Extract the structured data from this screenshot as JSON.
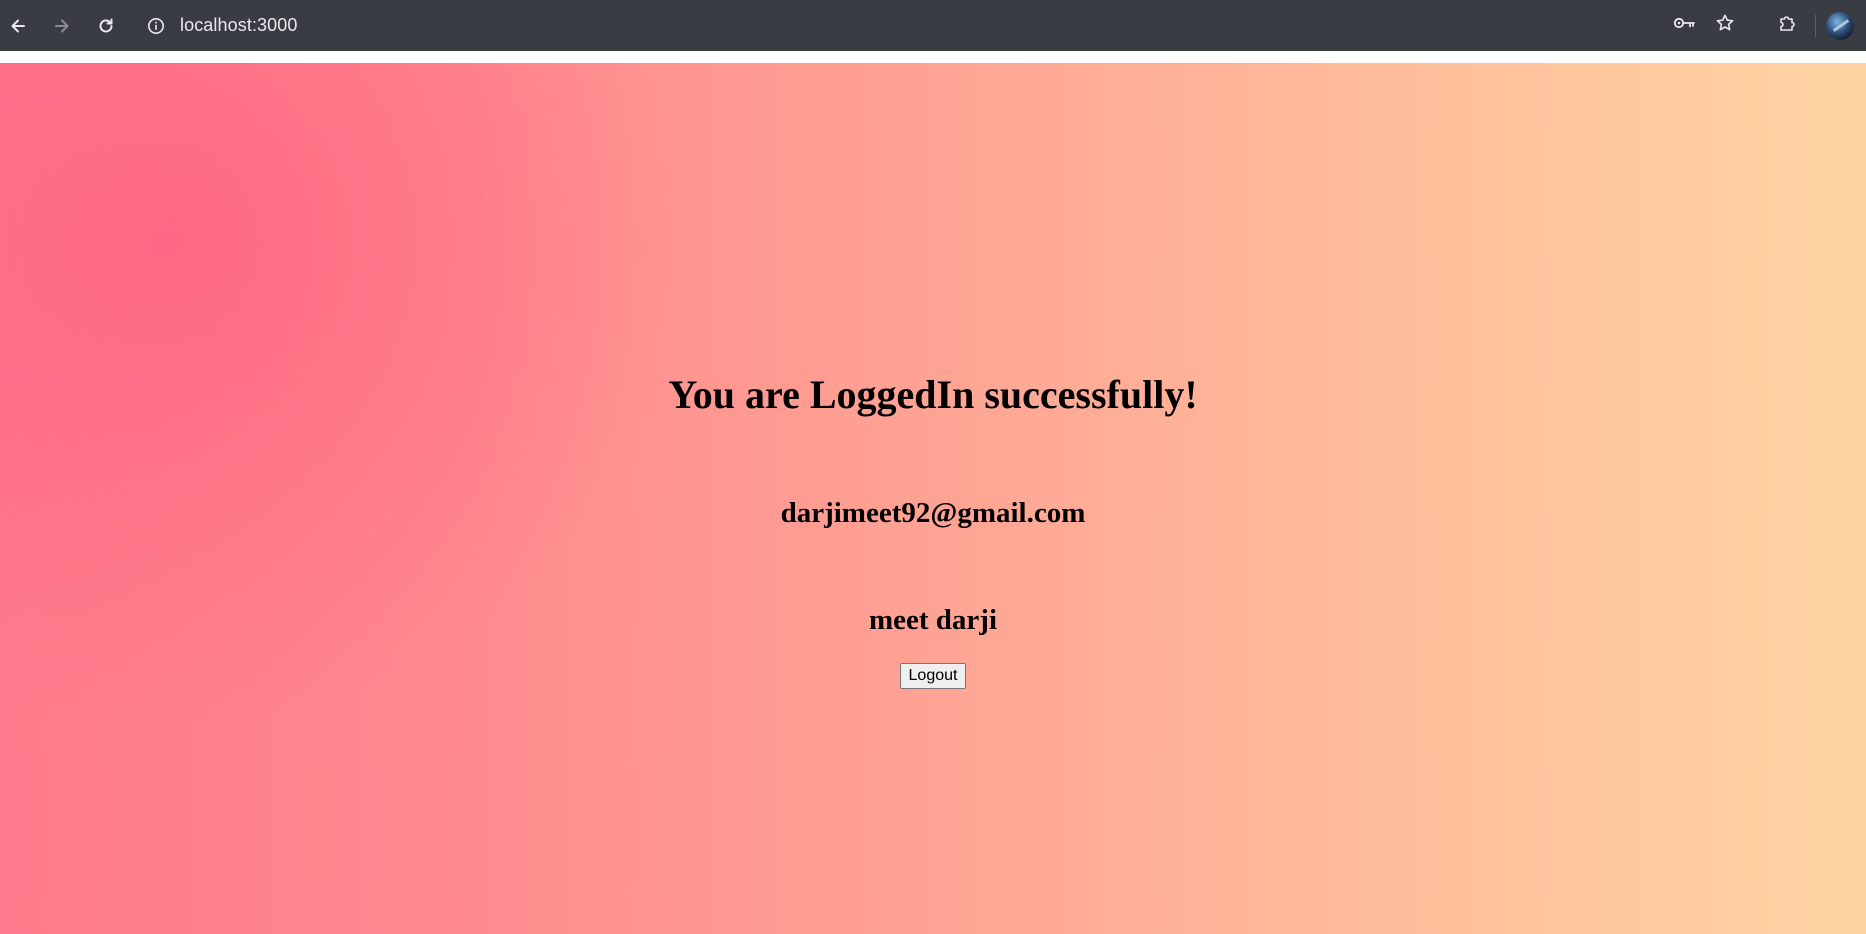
{
  "browser": {
    "url": "localhost:3000",
    "icons": {
      "back": "arrow-left-icon",
      "forward": "arrow-right-icon",
      "reload": "reload-icon",
      "site_info": "info-icon",
      "password_key": "key-icon",
      "bookmark": "star-icon",
      "extensions": "puzzle-icon",
      "profile": "avatar"
    },
    "forward_disabled": true
  },
  "page": {
    "headline": "You are LoggedIn successfully!",
    "email": "darjimeet92@gmail.com",
    "name": "meet darji",
    "logout_label": "Logout"
  },
  "colors": {
    "toolbar_bg": "#3a3c43",
    "gradient_start": "#ff6b86",
    "gradient_end": "#ffd4a2"
  }
}
